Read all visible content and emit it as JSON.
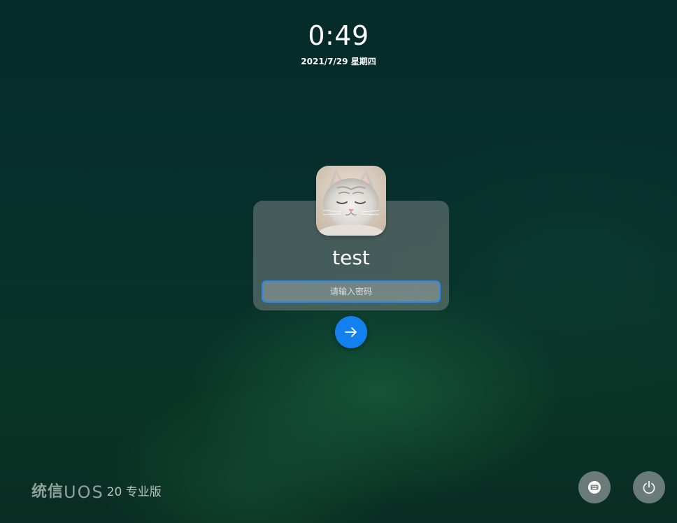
{
  "clock": {
    "time": "0:49",
    "date": "2021/7/29 星期四"
  },
  "login": {
    "avatar_icon": "cat-avatar",
    "username": "test",
    "password_placeholder": "请输入密码",
    "password_value": "",
    "submit_icon": "arrow-right-icon"
  },
  "branding": {
    "name_cn": "统信",
    "name_uos": "UOS",
    "edition": "20 专业版"
  },
  "controls": {
    "keyboard_icon": "keyboard-icon",
    "power_icon": "power-icon"
  },
  "colors": {
    "accent": "#1380f0",
    "input_border": "#1f8df5",
    "background": "#062b2a"
  }
}
